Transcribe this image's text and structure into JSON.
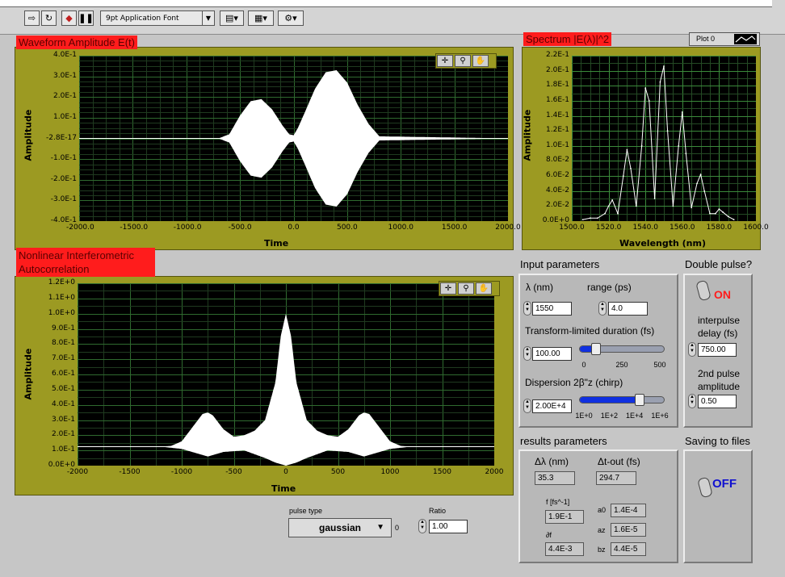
{
  "toolbar": {
    "font_select": "9pt Application Font",
    "icons": [
      "run-arrow-icon",
      "run-continuous-icon",
      "abort-icon",
      "pause-icon",
      "align-icon",
      "distribute-icon",
      "reorder-icon"
    ]
  },
  "waveform": {
    "title": "Waveform Amplitude E(t)",
    "xlabel": "Time",
    "ylabel": "Amplitude",
    "xticks": [
      "-2000.0",
      "-1500.0",
      "-1000.0",
      "-500.0",
      "0.0",
      "500.0",
      "1000.0",
      "1500.0",
      "2000.0"
    ],
    "yticks": [
      "4.0E-1",
      "3.0E-1",
      "2.0E-1",
      "1.0E-1",
      "-2.8E-17",
      "-1.0E-1",
      "-2.0E-1",
      "-3.0E-1",
      "-4.0E-1"
    ]
  },
  "spectrum": {
    "title": "Spectrum |E(λ)|^2",
    "legend": "Plot 0",
    "xlabel": "Wavelength (nm)",
    "ylabel": "Amplitude",
    "xticks": [
      "1500.0",
      "1520.0",
      "1540.0",
      "1560.0",
      "1580.0",
      "1600.0"
    ],
    "yticks": [
      "2.2E-1",
      "2.0E-1",
      "1.8E-1",
      "1.6E-1",
      "1.4E-1",
      "1.2E-1",
      "1.0E-1",
      "8.0E-2",
      "6.0E-2",
      "4.0E-2",
      "2.0E-2",
      "0.0E+0"
    ]
  },
  "autocorr": {
    "title_line1": "Nonlinear Interferometric",
    "title_line2": "Autocorrelation",
    "xlabel": "Time",
    "ylabel": "Amplitude",
    "xticks": [
      "-2000",
      "-1500",
      "-1000",
      "-500",
      "0",
      "500",
      "1000",
      "1500",
      "2000"
    ],
    "yticks": [
      "1.2E+0",
      "1.1E+0",
      "1.0E+0",
      "9.0E-1",
      "8.0E-1",
      "7.0E-1",
      "6.0E-1",
      "5.0E-1",
      "4.0E-1",
      "3.0E-1",
      "2.0E-1",
      "1.0E-1",
      "0.0E+0"
    ]
  },
  "input": {
    "heading": "Input parameters",
    "lambda_label": "λ (nm)",
    "lambda_value": "1550",
    "range_label": "range (ps)",
    "range_value": "4.0",
    "duration_label": "Transform-limited duration (fs)",
    "duration_value": "100.00",
    "duration_ticks": [
      "0",
      "250",
      "500"
    ],
    "duration_fraction": 0.2,
    "dispersion_label": "Dispersion 2β\"z (chirp)",
    "dispersion_value": "2.00E+4",
    "dispersion_ticks": [
      "1E+0",
      "1E+2",
      "1E+4",
      "1E+6"
    ],
    "dispersion_fraction": 0.72
  },
  "double": {
    "heading": "Double pulse?",
    "state": "ON",
    "delay_label_1": "interpulse",
    "delay_label_2": "delay (fs)",
    "delay_value": "750.00",
    "amp_label_1": "2nd pulse",
    "amp_label_2": "amplitude",
    "amp_value": "0.50"
  },
  "results": {
    "heading": "results parameters",
    "dlambda_label": "Δλ (nm)",
    "dlambda_value": "35.3",
    "dtout_label": "Δt-out (fs)",
    "dtout_value": "294.7",
    "f_label": "f [fs^-1]",
    "f_value": "1.9E-1",
    "df_label": "∂f",
    "df_value": "4.4E-3",
    "a0_label": "a0",
    "a0_value": "1.4E-4",
    "az_label": "az",
    "az_value": "1.6E-5",
    "bz_label": "bz",
    "bz_value": "4.4E-5"
  },
  "saving": {
    "heading": "Saving to files",
    "state": "OFF"
  },
  "pulse": {
    "label": "pulse type",
    "value": "gaussian",
    "index": "0",
    "ratio_label": "Ratio",
    "ratio_value": "1.00"
  },
  "chart_data": [
    {
      "type": "line",
      "title": "Waveform Amplitude E(t)",
      "xlabel": "Time",
      "ylabel": "Amplitude",
      "xlim": [
        -2000,
        2000
      ],
      "ylim": [
        -0.4,
        0.4
      ],
      "grid": true,
      "description_envelope": {
        "x": [
          -2000,
          -700,
          -600,
          -500,
          -400,
          -300,
          -200,
          -100,
          -40,
          0,
          40,
          100,
          200,
          300,
          400,
          500,
          600,
          700,
          800,
          2000
        ],
        "y": [
          0,
          0,
          0.02,
          0.11,
          0.18,
          0.19,
          0.14,
          0.06,
          0.02,
          0.015,
          0.05,
          0.12,
          0.24,
          0.32,
          0.33,
          0.27,
          0.16,
          0.07,
          0.01,
          0
        ]
      }
    },
    {
      "type": "line",
      "title": "Spectrum |E(λ)|^2",
      "xlabel": "Wavelength (nm)",
      "ylabel": "Amplitude",
      "xlim": [
        1500,
        1600
      ],
      "ylim": [
        0,
        0.22
      ],
      "grid": true,
      "series": [
        {
          "name": "Plot 0",
          "x": [
            1506,
            1510,
            1514,
            1518,
            1520,
            1522,
            1525,
            1528,
            1530,
            1532,
            1535,
            1538,
            1540,
            1542,
            1545,
            1548,
            1550,
            1552,
            1555,
            1558,
            1560,
            1562,
            1565,
            1568,
            1570,
            1572,
            1575,
            1578,
            1580,
            1582,
            1585,
            1588
          ],
          "y": [
            0.002,
            0.004,
            0.004,
            0.01,
            0.02,
            0.028,
            0.01,
            0.06,
            0.095,
            0.07,
            0.02,
            0.1,
            0.177,
            0.16,
            0.03,
            0.185,
            0.206,
            0.12,
            0.02,
            0.1,
            0.145,
            0.09,
            0.018,
            0.05,
            0.062,
            0.04,
            0.01,
            0.01,
            0.016,
            0.012,
            0.006,
            0.002
          ]
        }
      ]
    },
    {
      "type": "line",
      "title": "Nonlinear Interferometric Autocorrelation",
      "xlabel": "Time",
      "ylabel": "Amplitude",
      "xlim": [
        -2000,
        2000
      ],
      "ylim": [
        0,
        1.2
      ],
      "grid": true,
      "baseline": 0.125,
      "upper_envelope": {
        "x": [
          -2000,
          -1200,
          -1100,
          -1000,
          -900,
          -800,
          -750,
          -700,
          -600,
          -500,
          -400,
          -300,
          -200,
          -100,
          -50,
          0,
          50,
          100,
          200,
          300,
          400,
          500,
          600,
          700,
          750,
          800,
          900,
          1000,
          1100,
          1200,
          2000
        ],
        "y": [
          0.125,
          0.125,
          0.13,
          0.16,
          0.25,
          0.34,
          0.35,
          0.33,
          0.24,
          0.19,
          0.2,
          0.23,
          0.3,
          0.55,
          0.85,
          1.0,
          0.85,
          0.55,
          0.3,
          0.23,
          0.2,
          0.19,
          0.24,
          0.33,
          0.35,
          0.34,
          0.25,
          0.16,
          0.13,
          0.125,
          0.125
        ]
      },
      "lower_envelope": {
        "x": [
          -2000,
          -1200,
          -1000,
          -800,
          -750,
          -600,
          -400,
          -200,
          -100,
          0,
          100,
          200,
          400,
          600,
          750,
          800,
          1000,
          1200,
          2000
        ],
        "y": [
          0.125,
          0.125,
          0.11,
          0.07,
          0.06,
          0.09,
          0.1,
          0.05,
          0.02,
          0.0,
          0.02,
          0.05,
          0.1,
          0.09,
          0.06,
          0.07,
          0.11,
          0.125,
          0.125
        ]
      }
    }
  ]
}
